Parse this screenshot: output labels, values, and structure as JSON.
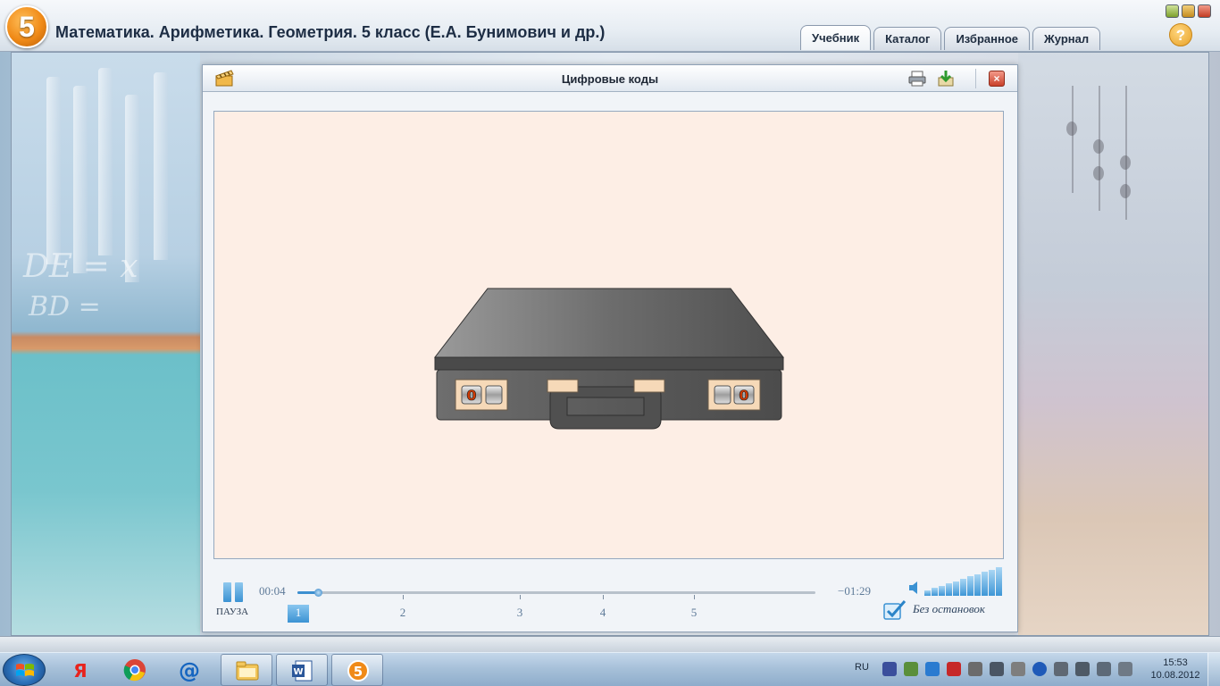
{
  "app": {
    "logo_number": "5",
    "title": "Математика. Арифметика. Геометрия. 5 класс (Е.А. Бунимович и др.)"
  },
  "tabs": [
    {
      "label": "Учебник",
      "active": true
    },
    {
      "label": "Каталог",
      "active": false
    },
    {
      "label": "Избранное",
      "active": false
    },
    {
      "label": "Журнал",
      "active": false
    }
  ],
  "help_label": "?",
  "dialog": {
    "title": "Цифровые коды",
    "close_label": "×"
  },
  "briefcase": {
    "left_lock_digit": "0",
    "right_lock_digit": "0"
  },
  "player": {
    "pause_label": "ПАУЗА",
    "elapsed": "00:04",
    "remaining": "−01:29",
    "progress_fraction": 0.04,
    "chapters": [
      {
        "label": "1",
        "active": true
      },
      {
        "label": "2",
        "active": false
      },
      {
        "label": "3",
        "active": false
      },
      {
        "label": "4",
        "active": false
      },
      {
        "label": "5",
        "active": false
      }
    ],
    "nonstop_label": "Без остановок",
    "nonstop_checked": true,
    "volume_level": 1.0
  },
  "taskbar": {
    "apps": [
      "yandex-browser",
      "chrome",
      "mail-agent",
      "file-explorer",
      "word",
      "textbook-app"
    ],
    "language": "RU",
    "time": "15:53",
    "date": "10.08.2012"
  },
  "colors": {
    "accent": "#3b92d3",
    "stage_bg": "#fdeee5",
    "logo_orange": "#f08a17"
  }
}
